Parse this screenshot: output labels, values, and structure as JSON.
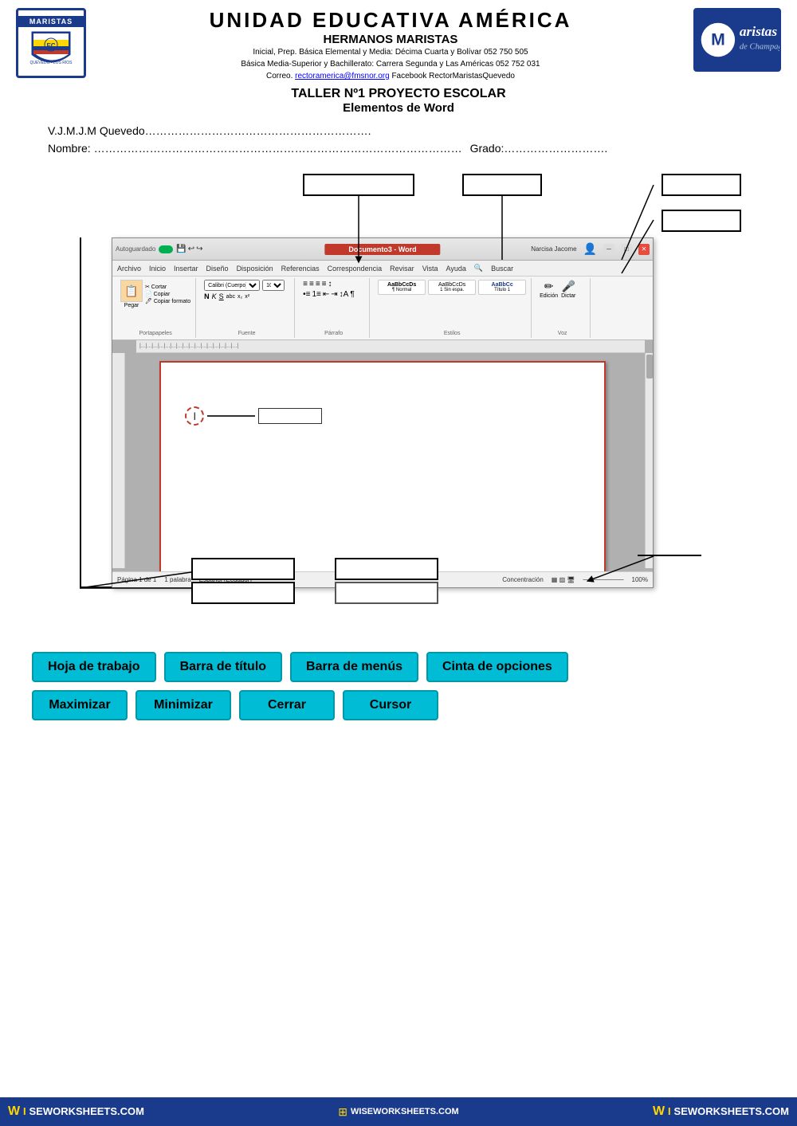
{
  "header": {
    "institution": "UNIDAD EDUCATIVA   AMÉRICA",
    "subtitle": "HERMANOS MARISTAS",
    "info_line1": "Inicial, Prep. Básica Elemental y Media: Décima Cuarta y Bolívar  052 750  505",
    "info_line2": "Básica Media-Superior y Bachillerato: Carrera Segunda y Las Américas  052 752  031",
    "info_line3": "Correo.",
    "email": "rectoramerica@fmsnor.org",
    "facebook": "Facebook RectorMaristasQuevedo",
    "taller_title": "TALLER Nº1 PROYECTO ESCOLAR",
    "taller_subtitle": "Elementos de Word",
    "logo_left_top": "MARISTAS",
    "logo_right_brand": "Maristas",
    "logo_right_sub": "de Champagnat"
  },
  "student": {
    "vjmjm": "V.J.M.J.M Quevedo…………………………………………………….",
    "nombre_label": "Nombre: ………………………………………………………………………………………",
    "grado_label": "Grado:………………………."
  },
  "word_ui": {
    "titlebar": {
      "autosave": "Autoguardado",
      "filename": "Documento3 - Word",
      "user": "Narcisa Jacome"
    },
    "menubar": {
      "items": [
        "Archivo",
        "Inicio",
        "Insertar",
        "Diseño",
        "Disposición",
        "Referencias",
        "Correspondencia",
        "Revisar",
        "Vista",
        "Ayuda",
        "Buscar"
      ]
    },
    "ribbon_groups": [
      {
        "label": "Portapapeles",
        "content": "Pegar"
      },
      {
        "label": "Fuente",
        "content": "Calibri (Cuerpo)  N K S"
      },
      {
        "label": "Párrafo",
        "content": "≡ ≡ ≡"
      },
      {
        "label": "Estilos",
        "content": "1 Normal  1 Sin espa.  Título 1"
      },
      {
        "label": "Voz",
        "content": "Edición  Dictar"
      }
    ],
    "statusbar": "Página 1 de 1   1 palabra   Español (Ecuador)   Concentración   100%"
  },
  "diagram_labels": {
    "top_right_1": "",
    "top_right_2": "",
    "top_right_3": "",
    "bottom_left_1": "",
    "bottom_left_2": "",
    "bottom_right_1": "",
    "bottom_right_2": ""
  },
  "bottom_chips": {
    "row1": [
      "Hoja de trabajo",
      "Barra de título",
      "Barra de menús",
      "Cinta de opciones"
    ],
    "row2": [
      "Maximizar",
      "Minimizar",
      "Cerrar",
      "Cursor"
    ]
  },
  "footer": {
    "left": "WISEWORKSHEETS.COM",
    "right": "WISEWORKSHEETS.COM"
  }
}
